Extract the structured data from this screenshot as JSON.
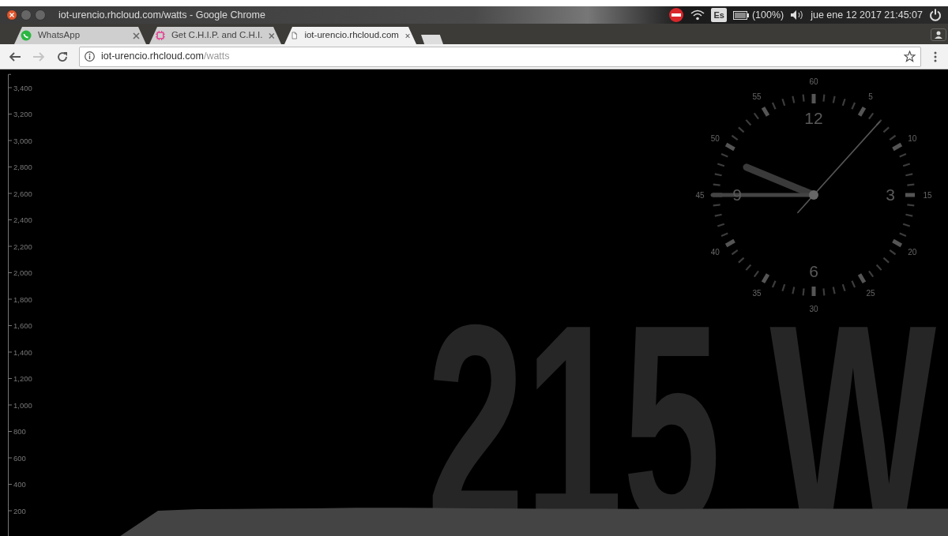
{
  "window": {
    "title": "iot-urencio.rhcloud.com/watts - Google Chrome"
  },
  "system_tray": {
    "keyboard_layout": "Es",
    "battery": "(100%)",
    "datetime": "jue ene 12 2017 21:45:07"
  },
  "tabs": [
    {
      "label": "WhatsApp",
      "kind": "whatsapp",
      "selected": false
    },
    {
      "label": "Get C.H.I.P. and C.H.I.",
      "kind": "chip",
      "selected": false
    },
    {
      "label": "iot-urencio.rhcloud.com",
      "kind": "page",
      "selected": true
    }
  ],
  "nav_buttons": [
    {
      "kind": "back",
      "disabled": false
    },
    {
      "kind": "forward",
      "disabled": true
    },
    {
      "kind": "reload",
      "disabled": false
    }
  ],
  "address_bar": {
    "host": "iot-urencio.rhcloud.com",
    "path": "/watts"
  },
  "chart": {
    "chart_data": {
      "type": "area",
      "series": [
        {
          "color": "#444444",
          "values": [
            0,
            0,
            0,
            0,
            200,
            212,
            214,
            216,
            218,
            222,
            222,
            220,
            218,
            216,
            215,
            215,
            214,
            214,
            215,
            216,
            216,
            215,
            215,
            215,
            215
          ]
        }
      ],
      "ylim": [
        0,
        3500
      ],
      "yticks": [
        {
          "value": 200,
          "label": "200"
        },
        {
          "value": 400,
          "label": "400"
        },
        {
          "value": 600,
          "label": "600"
        },
        {
          "value": 800,
          "label": "800"
        },
        {
          "value": 1000,
          "label": "1,000"
        },
        {
          "value": 1200,
          "label": "1,200"
        },
        {
          "value": 1400,
          "label": "1,400"
        },
        {
          "value": 1600,
          "label": "1,600"
        },
        {
          "value": 1800,
          "label": "1,800"
        },
        {
          "value": 2000,
          "label": "2,000"
        },
        {
          "value": 2200,
          "label": "2,200"
        },
        {
          "value": 2400,
          "label": "2,400"
        },
        {
          "value": 2600,
          "label": "2,600"
        },
        {
          "value": 2800,
          "label": "2,800"
        },
        {
          "value": 3000,
          "label": "3,000"
        },
        {
          "value": 3200,
          "label": "3,200"
        },
        {
          "value": 3400,
          "label": "3,400"
        }
      ]
    }
  },
  "clock": {
    "minute_labels": [
      "60",
      "5",
      "10",
      "15",
      "20",
      "25",
      "30",
      "35",
      "40",
      "45",
      "50",
      "55"
    ],
    "hour_labels": [
      "12",
      "3",
      "6",
      "9"
    ]
  },
  "reading": "215 W"
}
